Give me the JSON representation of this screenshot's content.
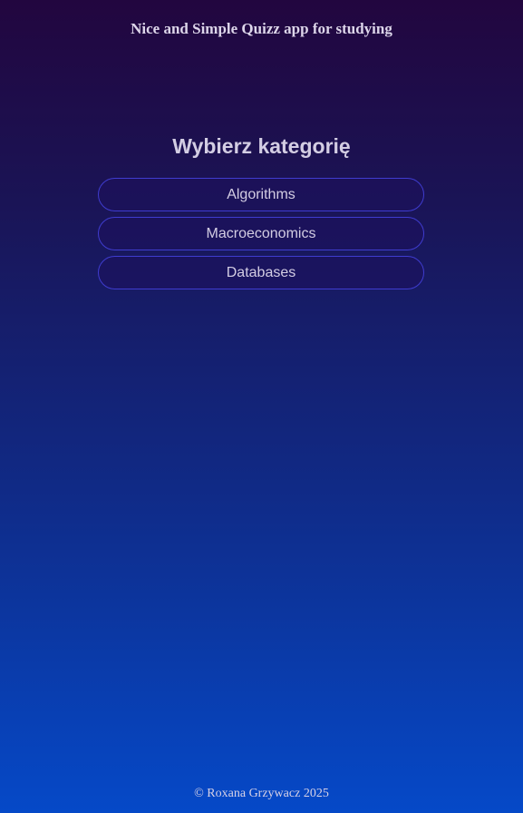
{
  "header": {
    "title": "Nice and Simple Quizz app for studying"
  },
  "main": {
    "heading": "Wybierz kategorię",
    "categories": [
      {
        "label": "Algorithms"
      },
      {
        "label": "Macroeconomics"
      },
      {
        "label": "Databases"
      }
    ]
  },
  "footer": {
    "text": "© Roxana Grzywacz 2025"
  },
  "colors": {
    "background_top": "#22063f",
    "background_bottom": "#0549c8",
    "button_border": "#3f3ccf"
  }
}
